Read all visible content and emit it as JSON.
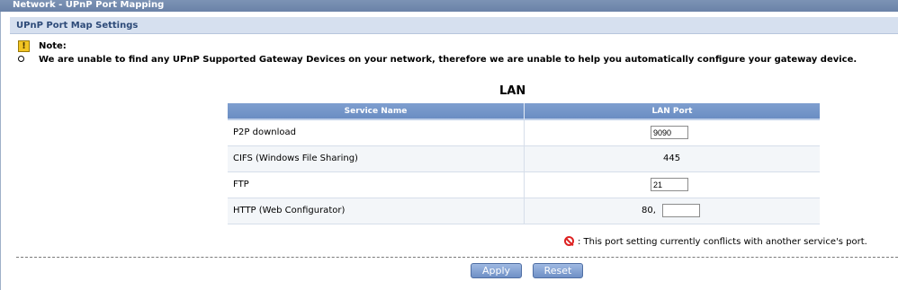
{
  "window": {
    "title": "Network - UPnP Port Mapping"
  },
  "section": {
    "title": "UPnP Port Map Settings"
  },
  "note": {
    "icon": "warning-icon",
    "label": "Note:",
    "bullet_icon": "bullet-icon",
    "text": "We are unable to find any UPnP Supported Gateway Devices on your network, therefore we are unable to help you automatically configure your gateway device."
  },
  "lan": {
    "title": "LAN",
    "columns": [
      "Service Name",
      "LAN Port"
    ],
    "rows": [
      {
        "service": "P2P download",
        "port_value": "9090"
      },
      {
        "service": "CIFS (Windows File Sharing)",
        "port_text": "445"
      },
      {
        "service": "FTP",
        "port_value": "21"
      },
      {
        "service": "HTTP (Web Configurator)",
        "port_text": "80,",
        "extra_value": ""
      }
    ]
  },
  "legend": {
    "icon": "conflict-icon",
    "text": ": This port setting currently conflicts with another service's port."
  },
  "buttons": {
    "apply": "Apply",
    "reset": "Reset"
  }
}
